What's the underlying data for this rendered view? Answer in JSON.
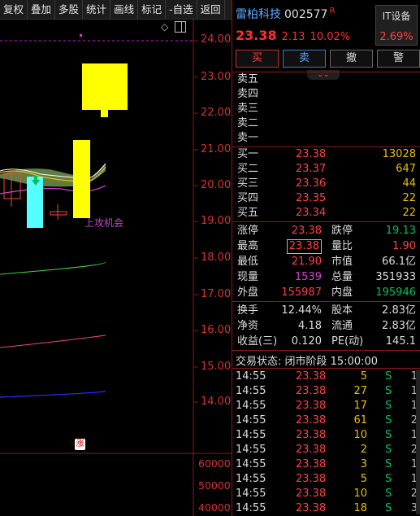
{
  "toolbar": [
    "复权",
    "叠加",
    "多股",
    "统计",
    "画线",
    "标记",
    "-自选",
    "返回"
  ],
  "chart": {
    "price_ticks": [
      "24.00",
      "23.00",
      "22.00",
      "21.00",
      "20.00",
      "19.00",
      "18.00",
      "17.00",
      "16.00",
      "15.00",
      "14.00"
    ],
    "volume_ticks": [
      "60000",
      "50000",
      "40000"
    ],
    "annotation": "上攻机会",
    "marker": "涨"
  },
  "stock": {
    "name": "雷柏科技",
    "code": "002577",
    "flag": "R",
    "price": "23.38",
    "change": "2.13",
    "change_pct": "10.02%",
    "sector_name": "IT设备",
    "sector_pct": "2.69%"
  },
  "trade_buttons": [
    "买",
    "卖",
    "撤",
    "警"
  ],
  "asks": [
    {
      "label": "卖五",
      "price": "",
      "vol": ""
    },
    {
      "label": "卖四",
      "price": "",
      "vol": ""
    },
    {
      "label": "卖三",
      "price": "",
      "vol": ""
    },
    {
      "label": "卖二",
      "price": "",
      "vol": ""
    },
    {
      "label": "卖一",
      "price": "",
      "vol": ""
    }
  ],
  "bids": [
    {
      "label": "买一",
      "price": "23.38",
      "vol": "13028"
    },
    {
      "label": "买二",
      "price": "23.37",
      "vol": "647"
    },
    {
      "label": "买三",
      "price": "23.36",
      "vol": "44"
    },
    {
      "label": "买四",
      "price": "23.35",
      "vol": "22"
    },
    {
      "label": "买五",
      "price": "23.34",
      "vol": "22"
    }
  ],
  "quote": {
    "limit_up_label": "涨停",
    "limit_up": "23.38",
    "limit_down_label": "跌停",
    "limit_down": "19.13",
    "high_label": "最高",
    "high": "23.38",
    "vol_ratio_label": "量比",
    "vol_ratio": "1.90",
    "low_label": "最低",
    "low": "21.90",
    "mktcap_label": "市值",
    "mktcap": "66.1亿",
    "cur_vol_label": "现量",
    "cur_vol": "1539",
    "total_vol_label": "总量",
    "total_vol": "351933",
    "outer_label": "外盘",
    "outer": "155987",
    "inner_label": "内盘",
    "inner": "195946",
    "turnover_label": "换手",
    "turnover": "12.44%",
    "equity_label": "股本",
    "equity": "2.83亿",
    "nav_label": "净资",
    "nav": "4.18",
    "float_label": "流通",
    "float": "2.83亿",
    "eps_label": "收益(三)",
    "eps": "0.120",
    "pe_label": "PE(动)",
    "pe": "145.1"
  },
  "status": "交易状态: 闭市阶段 15:00:00",
  "ticks": [
    {
      "t": "14:55",
      "p": "23.38",
      "q": "5",
      "s": "S",
      "c": "1"
    },
    {
      "t": "14:55",
      "p": "23.38",
      "q": "27",
      "s": "S",
      "c": "1"
    },
    {
      "t": "14:55",
      "p": "23.38",
      "q": "17",
      "s": "S",
      "c": "1"
    },
    {
      "t": "14:55",
      "p": "23.38",
      "q": "61",
      "s": "S",
      "c": "2"
    },
    {
      "t": "14:55",
      "p": "23.38",
      "q": "10",
      "s": "S",
      "c": "1"
    },
    {
      "t": "14:55",
      "p": "23.38",
      "q": "2",
      "s": "S",
      "c": "2"
    },
    {
      "t": "14:55",
      "p": "23.38",
      "q": "3",
      "s": "S",
      "c": "1"
    },
    {
      "t": "14:55",
      "p": "23.38",
      "q": "5",
      "s": "S",
      "c": "1"
    },
    {
      "t": "14:55",
      "p": "23.38",
      "q": "10",
      "s": "S",
      "c": "2"
    },
    {
      "t": "14:55",
      "p": "23.38",
      "q": "18",
      "s": "S",
      "c": "3"
    }
  ],
  "colors": {
    "up": "#ff4040",
    "down": "#00c060",
    "accent": "#5aa9ff",
    "volume": "#e8c000",
    "current_vol": "#d040d0"
  }
}
